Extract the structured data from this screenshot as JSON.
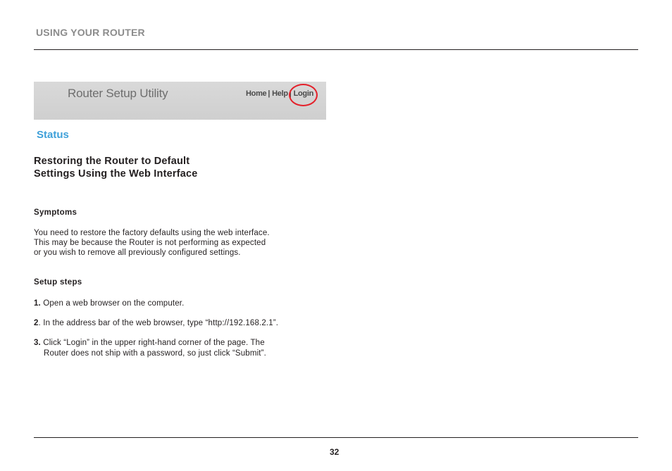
{
  "header": {
    "section_title": "USING YOUR ROUTER"
  },
  "utility_screenshot": {
    "title": "Router Setup Utility",
    "nav": {
      "home": "Home",
      "separator": "|",
      "help": "Help",
      "login": "Login"
    },
    "status_label": "Status",
    "highlight_color": "#e4202a",
    "status_color": "#3ea0d9"
  },
  "content": {
    "heading_line1": "Restoring the Router to Default",
    "heading_line2": "Settings Using the Web Interface",
    "symptoms_title": "Symptoms",
    "symptoms_lines": [
      "You need to restore the factory defaults using the web interface.",
      "This may be because the Router is not performing as expected",
      "or you wish to remove all previously configured settings."
    ],
    "setup_title": "Setup steps",
    "steps": [
      {
        "number": "1.",
        "text": " Open a web browser on the computer."
      },
      {
        "number": "2",
        "text": ". In the address bar of the web browser, type “http://192.168.2.1”."
      },
      {
        "number": "3.",
        "text_line1": " Click “Login” in the upper right-hand corner of the page. The",
        "text_line2": "Router does not ship with a password, so just click “Submit”."
      }
    ]
  },
  "footer": {
    "page_number": "32"
  }
}
